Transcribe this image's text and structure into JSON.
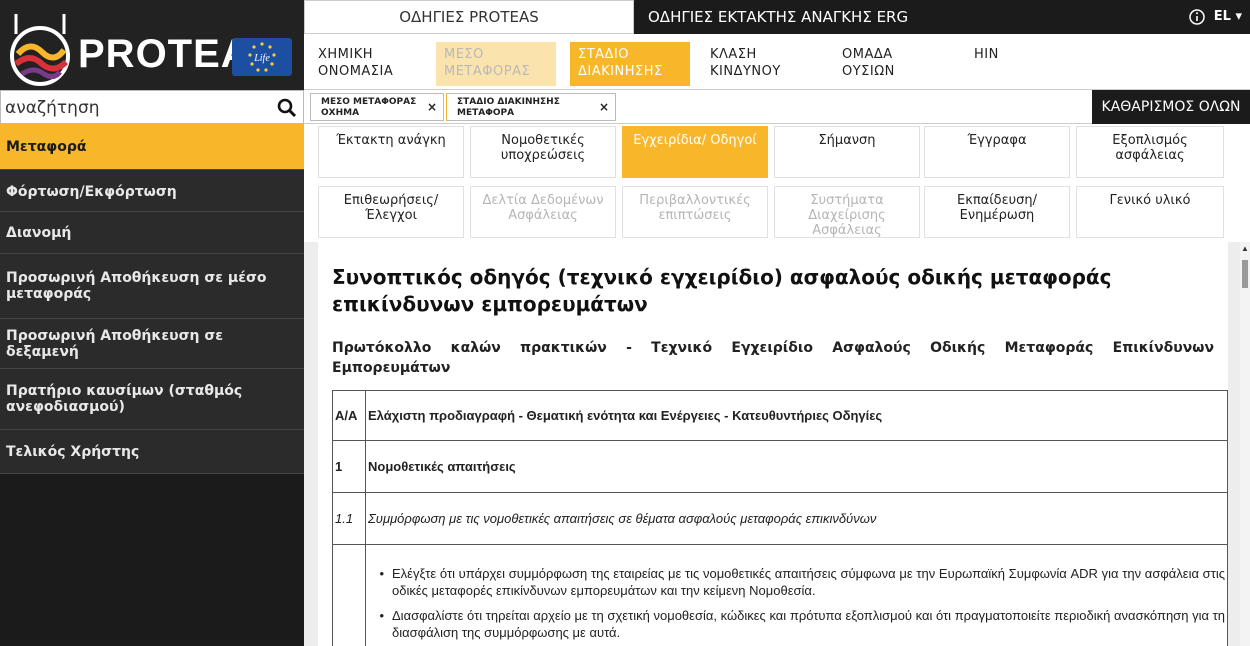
{
  "brand": {
    "name": "PROTEAS",
    "flag_text": "Life"
  },
  "search": {
    "placeholder": "αναζήτηση"
  },
  "sidebar": {
    "items": [
      {
        "label": "Μεταφορά",
        "active": true
      },
      {
        "label": "Φόρτωση/Εκφόρτωση"
      },
      {
        "label": "Διανομή"
      },
      {
        "label": "Προσωρινή Αποθήκευση σε μέσο μεταφοράς"
      },
      {
        "label": "Προσωρινή Αποθήκευση σε δεξαμενή"
      },
      {
        "label": "Πρατήριο καυσίμων (σταθμός ανεφοδιασμού)"
      },
      {
        "label": "Τελικός Χρήστης"
      }
    ]
  },
  "topbar": {
    "proteas_tab": "ΟΔΗΓΙΕΣ PROTEAS",
    "erg_tab": "ΟΔΗΓΙΕΣ ΕΚΤΑΚΤΗΣ ΑΝΑΓΚΗΣ ERG",
    "lang": "EL ▾"
  },
  "filters": [
    {
      "label": "ΧΗΜΙΚΗ ΟΝΟΜΑΣΙΑ"
    },
    {
      "label": "ΜΕΣΟ ΜΕΤΑΦΟΡΑΣ"
    },
    {
      "label": "ΣΤΑΔΙΟ ΔΙΑΚΙΝΗΣΗΣ"
    },
    {
      "label": "ΚΛΑΣΗ ΚΙΝΔΥΝΟΥ"
    },
    {
      "label": "ΟΜΑΔΑ ΟΥΣΙΩΝ"
    },
    {
      "label": "HIN"
    }
  ],
  "breadcrumbs": [
    {
      "label": "ΜΕΣΟ ΜΕΤΑΦΟΡΑΣ ΟΧΗΜΑ",
      "close": "×"
    },
    {
      "label": "ΣΤΑΔΙΟ ΔΙΑΚΙΝΗΣΗΣ ΜΕΤΑΦΟΡΑ",
      "close": "×"
    }
  ],
  "clear_all": "ΚΑΘΑΡΙΣΜΟΣ ΟΛΩΝ",
  "subtabs": [
    {
      "label": "Έκτακτη ανάγκη"
    },
    {
      "label": "Νομοθετικές υποχρεώσεις"
    },
    {
      "label": "Εγχειρίδια/ Οδηγοί",
      "active": true
    },
    {
      "label": "Σήμανση"
    },
    {
      "label": "Έγγραφα"
    },
    {
      "label": "Εξοπλισμός ασφάλειας"
    },
    {
      "label": "Επιθεωρήσεις/ Έλεγχοι"
    },
    {
      "label": "Δελτία Δεδομένων Ασφάλειας",
      "disabled": true
    },
    {
      "label": "Περιβαλλοντικές επιπτώσεις",
      "disabled": true
    },
    {
      "label": "Συστήματα Διαχείρισης Ασφάλειας",
      "disabled": true
    },
    {
      "label": "Εκπαίδευση/ Ενημέρωση"
    },
    {
      "label": "Γενικό υλικό"
    }
  ],
  "document": {
    "title": "Συνοπτικός οδηγός (τεχνικό εγχειρίδιο) ασφαλούς οδικής μεταφοράς επικίνδυνων εμπορευμάτων",
    "subtitle": "Πρωτόκολλο καλών πρακτικών - Τεχνικό Εγχειρίδιο Ασφαλούς Οδικής Μεταφοράς Επικίνδυνων Εμπορευμάτων",
    "table": {
      "header": {
        "num": "Α/Α",
        "text": "Ελάχιστη προδιαγραφή - Θεματική ενότητα και Ενέργειες - Κατευθυντήριες Οδηγίες"
      },
      "section": {
        "num": "1",
        "text": "Νομοθετικές απαιτήσεις"
      },
      "subsection": {
        "num": "1.1",
        "text": "Συμμόρφωση με τις νομοθετικές απαιτήσεις σε θέματα ασφαλούς μεταφοράς επικινδύνων"
      },
      "bullets": [
        "Ελέγξτε ότι υπάρχει συμμόρφωση της εταιρείας με τις νομοθετικές απαιτήσεις σύμφωνα με την Ευρωπαϊκή Συμφωνία ADR για την ασφάλεια στις οδικές μεταφορές επικίνδυνων εμπορευμάτων και την κείμενη Νομοθεσία.",
        "Διασφαλίστε ότι τηρείται αρχείο με τη σχετική νομοθεσία, κώδικες και πρότυπα εξοπλισμού και ότι πραγματοποιείτε περιοδική ανασκόπηση για τη διασφάλιση της συμμόρφωσης με αυτά."
      ]
    }
  },
  "colors": {
    "accent": "#f8b72b",
    "accent_faded": "#fbe3ad",
    "dark": "#1b1b1b",
    "nav_bg": "#2b2b2b"
  }
}
